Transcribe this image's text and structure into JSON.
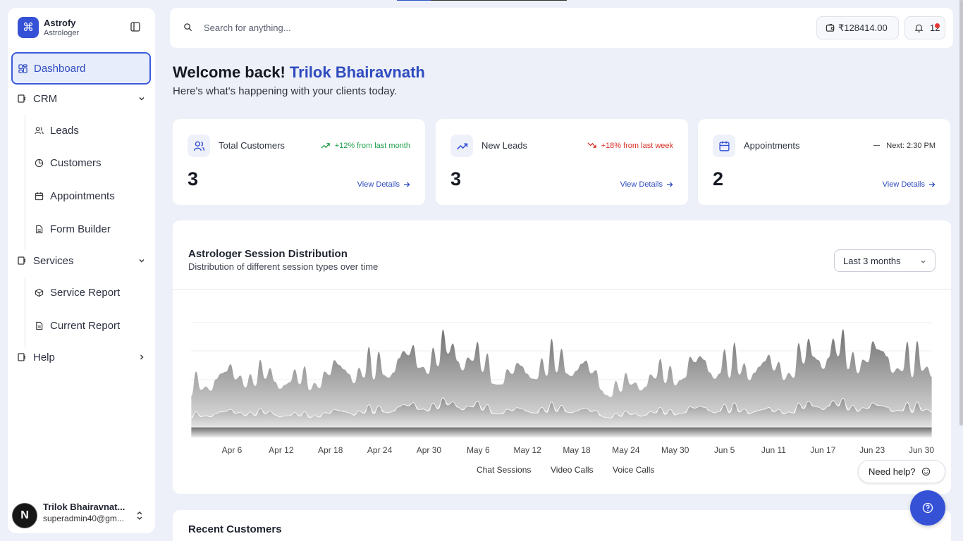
{
  "brand": {
    "name": "Astrofy",
    "role": "Astrologer"
  },
  "sidebar": {
    "dashboard": "Dashboard",
    "crm": {
      "label": "CRM",
      "items": [
        "Leads",
        "Customers",
        "Appointments",
        "Form Builder"
      ]
    },
    "services": {
      "label": "Services",
      "items": [
        "Service Report",
        "Current Report"
      ]
    },
    "help": "Help"
  },
  "user": {
    "initial": "N",
    "name": "Trilok Bhairavnat...",
    "email": "superadmin40@gm..."
  },
  "header": {
    "search_placeholder": "Search for anything...",
    "wallet_balance": "₹128414.00",
    "notification_count": "12"
  },
  "welcome": {
    "greeting": "Welcome back!",
    "name": "Trilok Bhairavnath",
    "subtitle": "Here's what's happening with your clients today."
  },
  "stats": [
    {
      "title": "Total Customers",
      "value": "3",
      "trend": "+12% from last month",
      "trend_dir": "up",
      "link": "View Details"
    },
    {
      "title": "New Leads",
      "value": "3",
      "trend": "+18% from last week",
      "trend_dir": "down",
      "link": "View Details"
    },
    {
      "title": "Appointments",
      "value": "2",
      "trend": "Next: 2:30 PM",
      "trend_dir": "neutral",
      "link": "View Details"
    }
  ],
  "colors": {
    "accent": "#3552d6",
    "trend_up": "#1e9e4a",
    "trend_down": "#d93025"
  },
  "chart_card": {
    "title": "Astrologer Session Distribution",
    "subtitle": "Distribution of different session types over time",
    "range": "Last 3 months"
  },
  "chart_data": {
    "type": "area",
    "stacked": true,
    "x": [
      "Apr 6",
      "Apr 12",
      "Apr 18",
      "Apr 24",
      "Apr 30",
      "May 6",
      "May 12",
      "May 18",
      "May 24",
      "May 30",
      "Jun 5",
      "Jun 11",
      "Jun 17",
      "Jun 23",
      "Jun 30"
    ],
    "series": [
      {
        "name": "Chat Sessions",
        "values": [
          8,
          10,
          9,
          11,
          12,
          14,
          9,
          13,
          7,
          10,
          12,
          11,
          14,
          13,
          12
        ]
      },
      {
        "name": "Video Calls",
        "values": [
          3,
          4,
          3,
          4,
          5,
          6,
          4,
          5,
          3,
          4,
          5,
          4,
          6,
          5,
          5
        ]
      },
      {
        "name": "Voice Calls",
        "values": [
          2,
          2,
          2,
          2,
          2,
          2,
          2,
          2,
          2,
          2,
          2,
          2,
          2,
          2,
          2
        ]
      }
    ],
    "grid": true,
    "legend": "bottom-center"
  },
  "legend_labels": [
    "Chat Sessions",
    "Video Calls",
    "Voice Calls"
  ],
  "recent": {
    "title": "Recent Customers"
  },
  "help_widget": {
    "label": "Need help?"
  }
}
